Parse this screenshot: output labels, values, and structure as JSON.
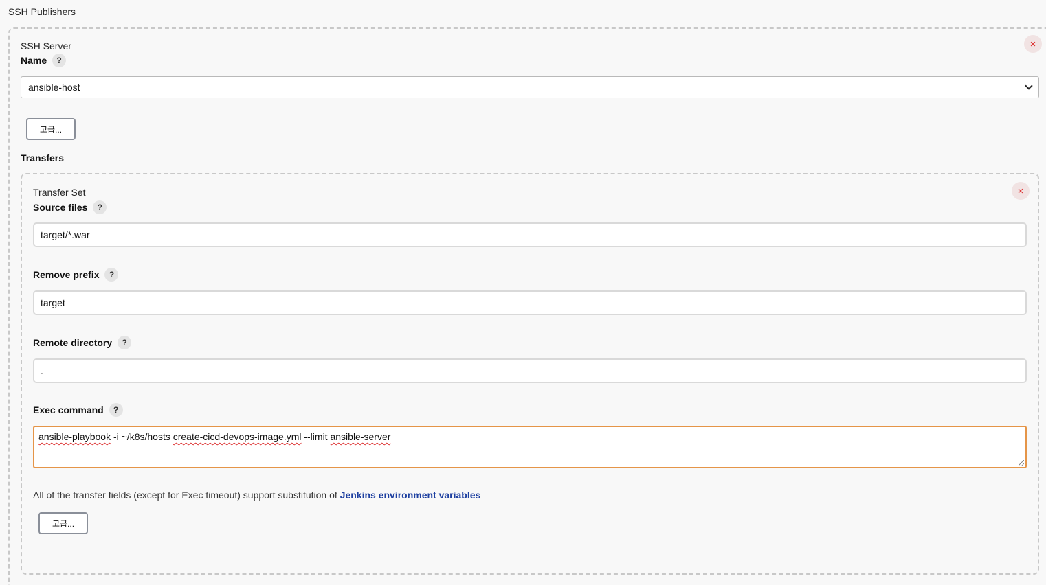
{
  "section_title": "SSH Publishers",
  "ssh_server": {
    "title": "SSH Server",
    "name_label": "Name",
    "name_value": "ansible-host",
    "advanced_label": "고급...",
    "close_symbol": "×"
  },
  "transfers": {
    "label": "Transfers",
    "transfer_set": {
      "title": "Transfer Set",
      "close_symbol": "×",
      "fields": {
        "source_files": {
          "label": "Source files",
          "value": "target/*.war"
        },
        "remove_prefix": {
          "label": "Remove prefix",
          "value": "target"
        },
        "remote_directory": {
          "label": "Remote directory",
          "value": "."
        },
        "exec_command": {
          "label": "Exec command",
          "parts": [
            "ansible-playbook",
            " -i ~/k8s/hosts ",
            "create-cicd-devops-image.yml",
            " --limit ",
            "ansible-server"
          ]
        }
      },
      "note_text": "All of the transfer fields (except for Exec timeout) support substitution of ",
      "note_link": "Jenkins environment variables",
      "advanced_label": "고급..."
    }
  },
  "help_symbol": "?",
  "colors": {
    "background": "#f8f8f8",
    "close_red": "#dd3333",
    "focus_orange": "#e59548",
    "link_blue": "#1d3fa0"
  }
}
